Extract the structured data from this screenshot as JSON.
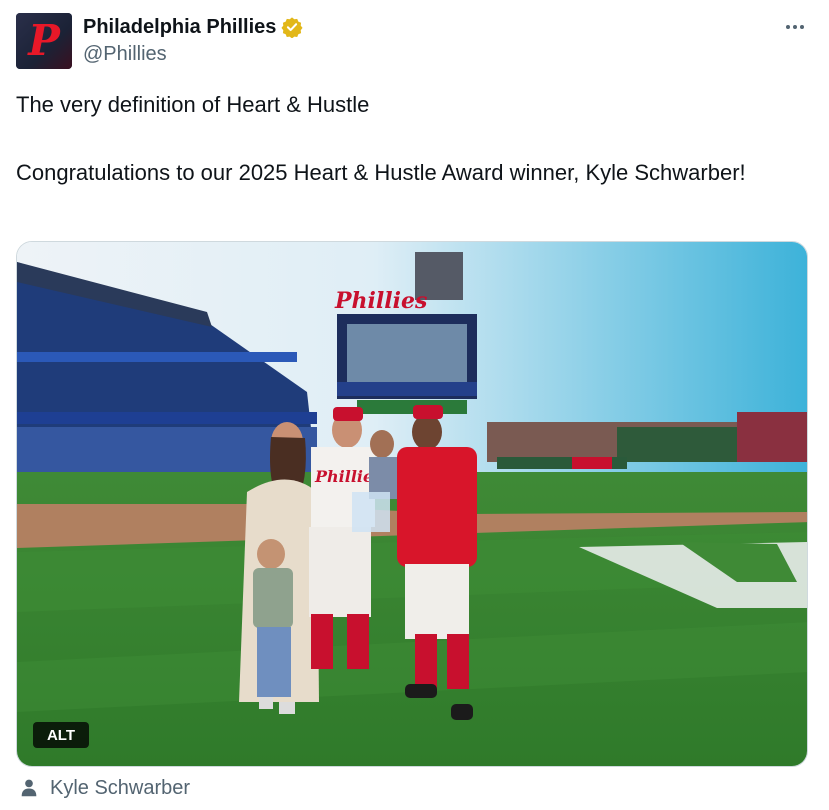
{
  "account": {
    "display_name": "Philadelphia Phillies",
    "handle": "@Phillies",
    "avatar_letter": "P",
    "verified_icon": "verified-gold-badge-icon"
  },
  "tweet": {
    "line1": "The very definition of Heart & Hustle",
    "line2": "Congratulations to our 2025 Heart & Hustle Award winner, Kyle Schwarber!"
  },
  "media": {
    "description_icon": "baseball-field-photo",
    "scoreboard_logo": "Phillies",
    "jersey_text": "Phillies",
    "alt_badge": "ALT"
  },
  "tagged": {
    "icon": "person-icon",
    "name": "Kyle Schwarber"
  },
  "more_icon": "more-horizontal-icon",
  "colors": {
    "phillies_red": "#e81828",
    "text_primary": "#0f1419",
    "text_secondary": "#536471",
    "verified_gold": "#e2b719"
  }
}
